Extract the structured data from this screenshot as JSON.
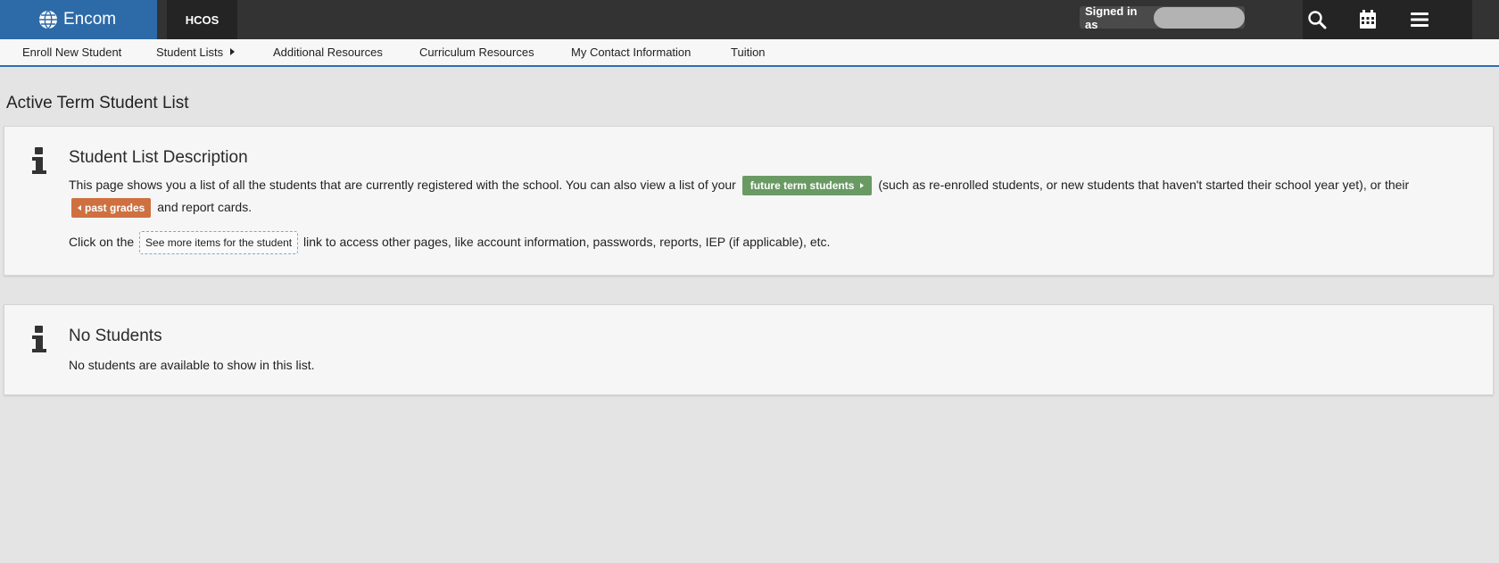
{
  "header": {
    "brand": "Encom",
    "org": "HCOS",
    "signed_in_label": "Signed in as",
    "tools": [
      "search-icon",
      "calendar-icon",
      "menu-icon"
    ]
  },
  "nav": {
    "items": [
      {
        "label": "Enroll New Student"
      },
      {
        "label": "Student Lists"
      },
      {
        "label": "Additional Resources"
      },
      {
        "label": "Curriculum Resources"
      },
      {
        "label": "My Contact Information"
      },
      {
        "label": "Tuition"
      }
    ]
  },
  "page": {
    "title": "Active Term Student List"
  },
  "description_panel": {
    "heading": "Student List Description",
    "p1_a": "This page shows you a list of all the students that are currently registered with the school. You can also view a list of your",
    "future_btn": "future term students",
    "p1_b": "(such as re-enrolled students, or new students that haven't started their school year yet), or their",
    "past_btn": "past grades",
    "p1_c": "and report cards.",
    "p2_a": "Click on the",
    "see_more": "See more items for the student",
    "p2_b": "link to access other pages, like account information, passwords, reports, IEP (if applicable), etc."
  },
  "empty_panel": {
    "heading": "No Students",
    "text": "No students are available to show in this list."
  },
  "colors": {
    "brand": "#2d6aa8",
    "topbar": "#333333",
    "nav_accent": "#2f6db4",
    "future_button": "#6a9a64",
    "past_button": "#cf7040"
  }
}
